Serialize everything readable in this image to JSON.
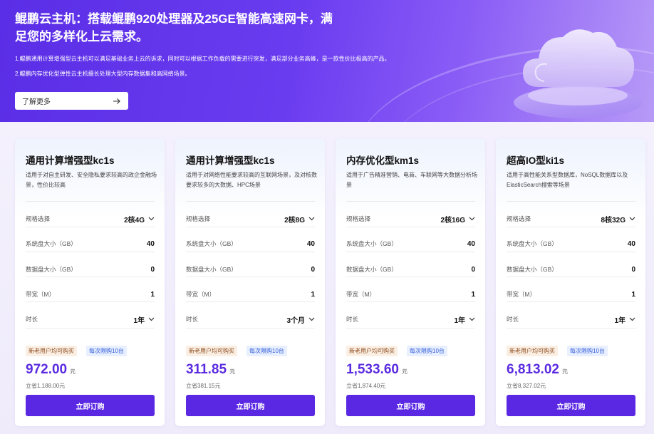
{
  "banner": {
    "title_line1": "鲲鹏云主机：搭载鲲鹏920处理器及25GE智能高速网卡，满",
    "title_line2": "足您的多样化上云需求。",
    "desc1": "1.鲲鹏通用计算增强型云主机可以满足基础业务上云的诉求，同时可以根据工作负载的需要进行突发，满足部分业务高峰，是一款性价比极高的产品。",
    "desc2": "2.鲲鹏内存优化型弹性云主机擅长处理大型内存数据集和高网络场景。",
    "learn_more": "了解更多",
    "colors": {
      "gradient_start": "#5a2ee6",
      "gradient_end": "#b79af7"
    }
  },
  "labels": {
    "spec": "规格选择",
    "system_disk": "系统盘大小（GB）",
    "data_disk": "数据盘大小（GB）",
    "bandwidth": "带宽（M）",
    "duration": "时长",
    "badge_new": "新老用户均可购买",
    "badge_limit": "每次限购10台",
    "unit": "元",
    "buy": "立即订购"
  },
  "cards": [
    {
      "title": "通用计算增强型kc1s",
      "desc": "适用于对自主研发、安全隐私要求较高的政企金融场景，性价比较高",
      "spec": "2核4G",
      "system_disk": "40",
      "data_disk": "0",
      "bandwidth": "1",
      "duration": "1年",
      "price": "972.00",
      "save": "立省1,188.00元"
    },
    {
      "title": "通用计算增强型kc1s",
      "desc": "适用于对网络性能要求较高的互联网场景，及对核数要求较多的大数据、HPC场景",
      "spec": "2核8G",
      "system_disk": "40",
      "data_disk": "0",
      "bandwidth": "1",
      "duration": "3个月",
      "price": "311.85",
      "save": "立省381.15元"
    },
    {
      "title": "内存优化型km1s",
      "desc": "适用于广告精准营销、电商、车联网等大数据分析场景",
      "spec": "2核16G",
      "system_disk": "40",
      "data_disk": "0",
      "bandwidth": "1",
      "duration": "1年",
      "price": "1,533.60",
      "save": "立省1,874.40元"
    },
    {
      "title": "超高IO型ki1s",
      "desc": "适用于高性能关系型数据库，NoSQL数据库以及ElasticSearch搜索等场景",
      "spec": "8核32G",
      "system_disk": "40",
      "data_disk": "0",
      "bandwidth": "1",
      "duration": "1年",
      "price": "6,813.02",
      "save": "立省8,327.02元"
    }
  ],
  "colors": {
    "accent": "#5a28e3",
    "price": "#5b2be0",
    "badge_new_bg": "#fbeee3",
    "badge_limit_bg": "#e8efff"
  }
}
